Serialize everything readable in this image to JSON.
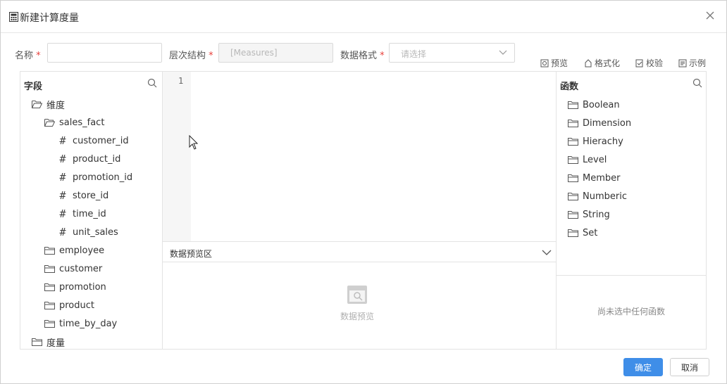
{
  "dialog": {
    "title": "新建计算度量",
    "title_icon": "calculator-icon",
    "close_icon": "close-icon"
  },
  "form": {
    "name_label": "名称",
    "name_value": "",
    "hierarchy_label": "层次结构",
    "hierarchy_value": "[Measures]",
    "format_label": "数据格式",
    "format_placeholder": "请选择",
    "required_mark": "*"
  },
  "toolbar": {
    "preview": "预览",
    "format": "格式化",
    "validate": "校验",
    "example": "示例"
  },
  "fields": {
    "header": "字段",
    "tree": [
      {
        "label": "维度",
        "type": "folder-open",
        "level": 0
      },
      {
        "label": "sales_fact",
        "type": "folder-open",
        "level": 1
      },
      {
        "label": "customer_id",
        "type": "field",
        "level": 2
      },
      {
        "label": "product_id",
        "type": "field",
        "level": 2
      },
      {
        "label": "promotion_id",
        "type": "field",
        "level": 2
      },
      {
        "label": "store_id",
        "type": "field",
        "level": 2
      },
      {
        "label": "time_id",
        "type": "field",
        "level": 2
      },
      {
        "label": "unit_sales",
        "type": "field",
        "level": 2
      },
      {
        "label": "employee",
        "type": "folder",
        "level": 1
      },
      {
        "label": "customer",
        "type": "folder",
        "level": 1
      },
      {
        "label": "promotion",
        "type": "folder",
        "level": 1
      },
      {
        "label": "product",
        "type": "folder",
        "level": 1
      },
      {
        "label": "time_by_day",
        "type": "folder",
        "level": 1
      },
      {
        "label": "度量",
        "type": "folder",
        "level": 0
      }
    ]
  },
  "editor": {
    "line_number": "1",
    "content": ""
  },
  "preview": {
    "header": "数据预览区",
    "empty_text": "数据预览"
  },
  "functions": {
    "header": "函数",
    "items": [
      "Boolean",
      "Dimension",
      "Hierachy",
      "Level",
      "Member",
      "Numberic",
      "String",
      "Set"
    ],
    "empty_text": "尚未选中任何函数"
  },
  "footer": {
    "ok": "确定",
    "cancel": "取消"
  },
  "colors": {
    "primary": "#3f8ee8",
    "required": "#e8413c"
  }
}
